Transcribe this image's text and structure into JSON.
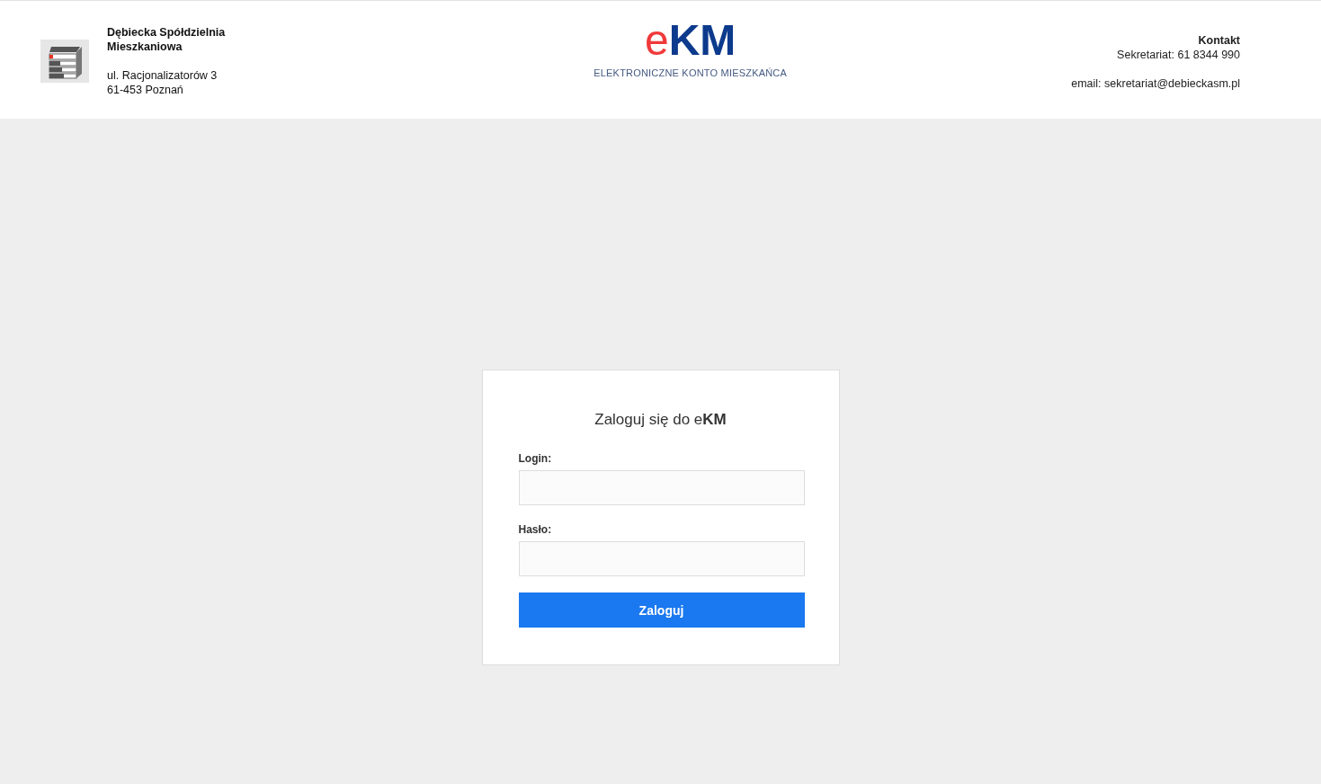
{
  "header": {
    "org_name": "Dębiecka Spółdzielnia Mieszkaniowa",
    "address_lines": [
      "ul. Racjonalizatorów 3",
      "61-453 Poznań"
    ],
    "logo": {
      "prefix": "e",
      "main": "KM",
      "subtitle": "ELEKTRONICZNE KONTO MIESZKAŃCA"
    },
    "contact": {
      "heading": "Kontakt",
      "phone": "Sekretariat: 61 8344 990",
      "email": "email: sekretariat@debieckasm.pl"
    }
  },
  "login": {
    "title": "Zaloguj się do e**KM**",
    "fields": [
      {
        "label": "Login:"
      },
      {
        "label": "Hasło:"
      }
    ],
    "button": "Zaloguj"
  }
}
